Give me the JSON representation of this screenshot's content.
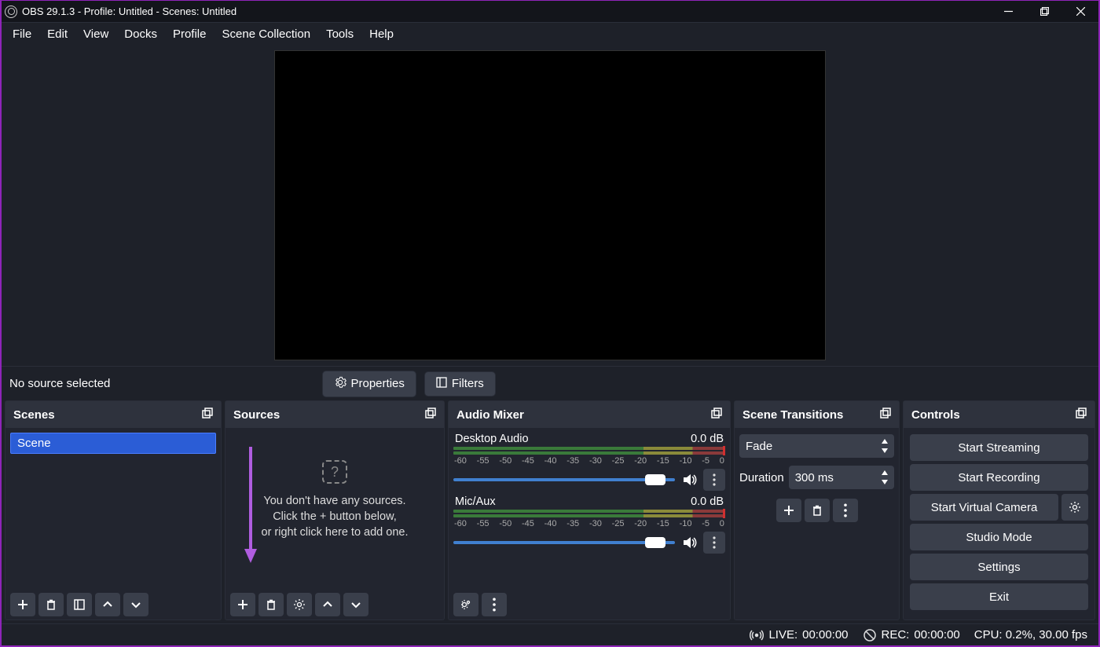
{
  "window": {
    "title": "OBS 29.1.3 - Profile: Untitled - Scenes: Untitled"
  },
  "menu": {
    "items": [
      "File",
      "Edit",
      "View",
      "Docks",
      "Profile",
      "Scene Collection",
      "Tools",
      "Help"
    ]
  },
  "preview_info": {
    "no_source": "No source selected",
    "properties": "Properties",
    "filters": "Filters"
  },
  "docks": {
    "scenes": {
      "title": "Scenes",
      "items": [
        "Scene"
      ]
    },
    "sources": {
      "title": "Sources",
      "empty1": "You don't have any sources.",
      "empty2": "Click the + button below,",
      "empty3": "or right click here to add one."
    },
    "mixer": {
      "title": "Audio Mixer",
      "ticks": [
        "-60",
        "-55",
        "-50",
        "-45",
        "-40",
        "-35",
        "-30",
        "-25",
        "-20",
        "-15",
        "-10",
        "-5",
        "0"
      ],
      "channels": [
        {
          "name": "Desktop Audio",
          "db": "0.0 dB"
        },
        {
          "name": "Mic/Aux",
          "db": "0.0 dB"
        }
      ]
    },
    "transitions": {
      "title": "Scene Transitions",
      "current": "Fade",
      "duration_label": "Duration",
      "duration_value": "300 ms"
    },
    "controls": {
      "title": "Controls",
      "start_streaming": "Start Streaming",
      "start_recording": "Start Recording",
      "start_vcam": "Start Virtual Camera",
      "studio_mode": "Studio Mode",
      "settings": "Settings",
      "exit": "Exit"
    }
  },
  "status": {
    "live_label": "LIVE:",
    "live_time": "00:00:00",
    "rec_label": "REC:",
    "rec_time": "00:00:00",
    "cpu": "CPU: 0.2%, 30.00 fps"
  }
}
